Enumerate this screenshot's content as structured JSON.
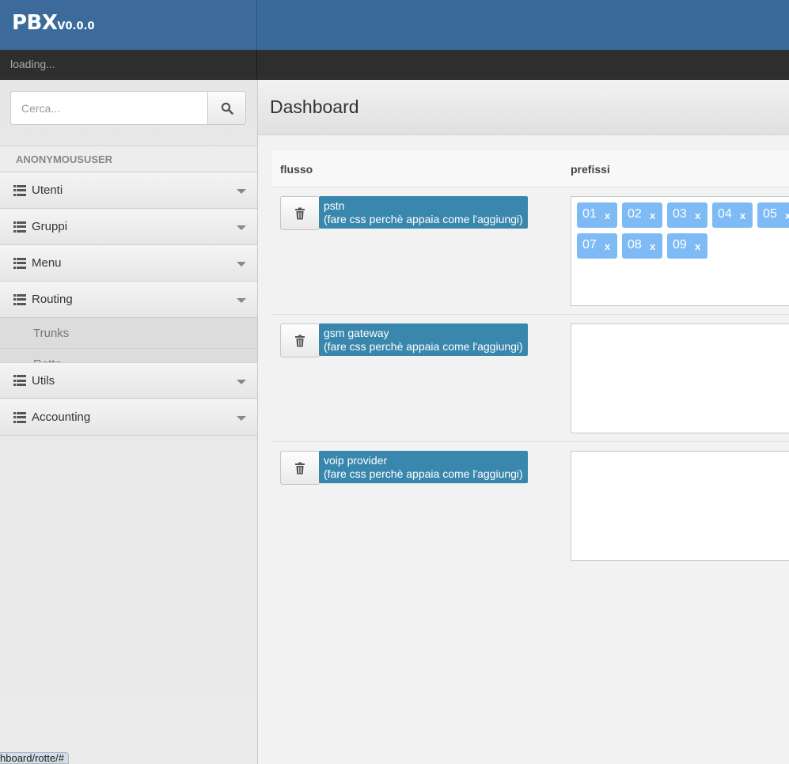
{
  "app": {
    "name": "PBX",
    "version": "V0.0.0",
    "status": "loading..."
  },
  "search": {
    "placeholder": "Cerca..."
  },
  "sidebar": {
    "user": "ANONYMOUSUSER",
    "items": [
      {
        "label": "Utenti"
      },
      {
        "label": "Gruppi"
      },
      {
        "label": "Menu"
      },
      {
        "label": "Routing"
      },
      {
        "label": "Utils"
      },
      {
        "label": "Accounting"
      }
    ],
    "routing_sub": [
      {
        "label": "Trunks"
      },
      {
        "label": "Rotte"
      }
    ]
  },
  "page": {
    "title": "Dashboard"
  },
  "table": {
    "headers": {
      "flusso": "flusso",
      "prefissi": "prefissi"
    },
    "rows": [
      {
        "name": "pstn",
        "note": "(fare css perchè appaia come l'aggiungi)",
        "prefixes": [
          "01",
          "02",
          "03",
          "04",
          "05",
          "07",
          "08",
          "09"
        ]
      },
      {
        "name": "gsm gateway",
        "note": "(fare css perchè appaia come l'aggiungi)",
        "prefixes": []
      },
      {
        "name": "voip provider",
        "note": "(fare css perchè appaia come l'aggiungi)",
        "prefixes": []
      }
    ],
    "chip_remove": "x"
  },
  "url_status": "hboard/rotte/#"
}
